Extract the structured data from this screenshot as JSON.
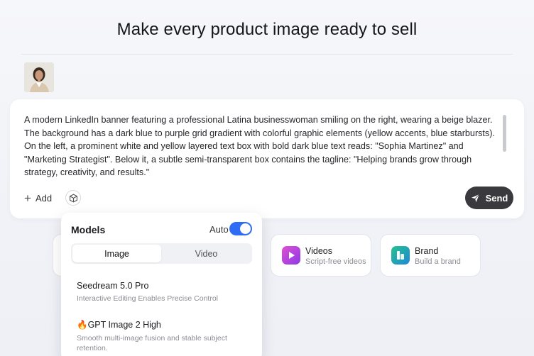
{
  "page": {
    "title": "Make every product image ready to sell"
  },
  "composer": {
    "prompt": "A modern LinkedIn banner featuring a professional Latina businesswoman smiling on the right, wearing a beige blazer. The background has a dark blue to purple grid gradient with colorful graphic elements (yellow accents, blue starbursts). On the left, a prominent white and yellow layered text box with bold dark blue text reads: \"Sophia Martinez\" and \"Marketing Strategist\". Below it, a subtle semi-transparent box contains the tagline: \"Helping brands grow through strategy, creativity, and results.\"",
    "add_label": "Add",
    "send_label": "Send"
  },
  "cards": [
    {
      "title": "Videos",
      "subtitle": "Script-free videos",
      "icon": "play-icon",
      "color": "#b740e0"
    },
    {
      "title": "Brand",
      "subtitle": "Build a brand",
      "icon": "brand-icon",
      "color": "#1ba77a"
    }
  ],
  "models_panel": {
    "title": "Models",
    "auto_label": "Auto",
    "auto_enabled": true,
    "tabs": [
      "Image",
      "Video"
    ],
    "active_tab": "Image",
    "items": [
      {
        "name": "Seedream 5.0 Pro",
        "desc": "Interactive Editing Enables Precise Control"
      },
      {
        "name": "🔥GPT Image 2 High",
        "desc": "Smooth multi-image fusion and stable subject retention."
      }
    ]
  },
  "colors": {
    "accent": "#2f6cf6",
    "send_bg": "#3a3a3e"
  }
}
